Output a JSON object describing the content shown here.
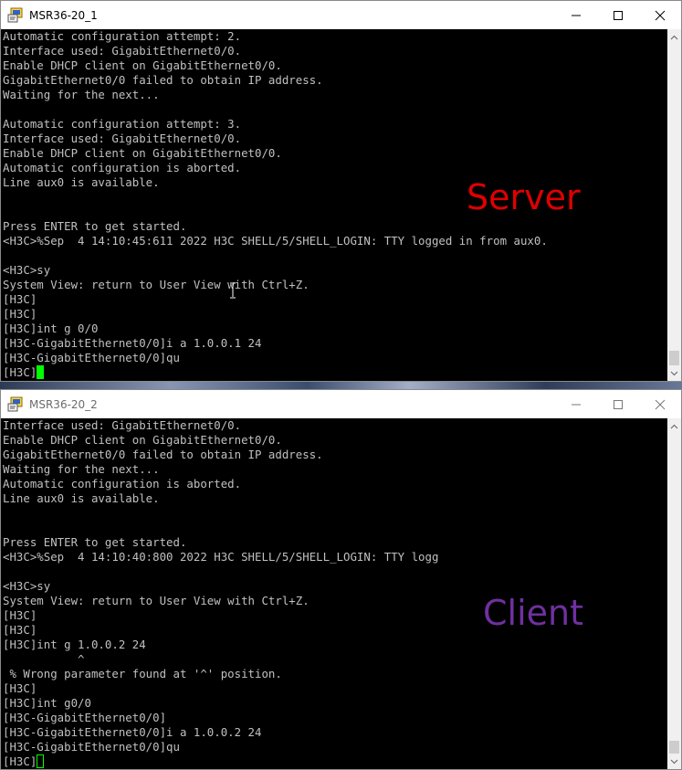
{
  "windows": [
    {
      "title": "MSR36-20_1",
      "overlay_label": "Server",
      "overlay_color": "#e00000",
      "lines": [
        "Automatic configuration attempt: 2.",
        "Interface used: GigabitEthernet0/0.",
        "Enable DHCP client on GigabitEthernet0/0.",
        "GigabitEthernet0/0 failed to obtain IP address.",
        "Waiting for the next...",
        "",
        "Automatic configuration attempt: 3.",
        "Interface used: GigabitEthernet0/0.",
        "Enable DHCP client on GigabitEthernet0/0.",
        "Automatic configuration is aborted.",
        "Line aux0 is available.",
        "",
        "",
        "Press ENTER to get started.",
        "<H3C>%Sep  4 14:10:45:611 2022 H3C SHELL/5/SHELL_LOGIN: TTY logged in from aux0.",
        "",
        "<H3C>sy",
        "System View: return to User View with Ctrl+Z.",
        "[H3C]",
        "[H3C]",
        "[H3C]int g 0/0",
        "[H3C-GigabitEthernet0/0]i a 1.0.0.1 24",
        "[H3C-GigabitEthernet0/0]qu",
        "[H3C]"
      ]
    },
    {
      "title": "MSR36-20_2",
      "overlay_label": "Client",
      "overlay_color": "#7030a0",
      "lines": [
        "Interface used: GigabitEthernet0/0.",
        "Enable DHCP client on GigabitEthernet0/0.",
        "GigabitEthernet0/0 failed to obtain IP address.",
        "Waiting for the next...",
        "Automatic configuration is aborted.",
        "Line aux0 is available.",
        "",
        "",
        "Press ENTER to get started.",
        "<H3C>%Sep  4 14:10:40:800 2022 H3C SHELL/5/SHELL_LOGIN: TTY logg",
        "",
        "<H3C>sy",
        "System View: return to User View with Ctrl+Z.",
        "[H3C]",
        "[H3C]",
        "[H3C]int g 1.0.0.2 24",
        "           ^",
        " % Wrong parameter found at '^' position.",
        "[H3C]",
        "[H3C]int g0/0",
        "[H3C-GigabitEthernet0/0]",
        "[H3C-GigabitEthernet0/0]i a 1.0.0.2 24",
        "[H3C-GigabitEthernet0/0]qu",
        "[H3C]"
      ]
    }
  ],
  "colors": {
    "console_bg": "#000000",
    "console_text": "#c0c0c0",
    "cursor": "#00ff00"
  }
}
